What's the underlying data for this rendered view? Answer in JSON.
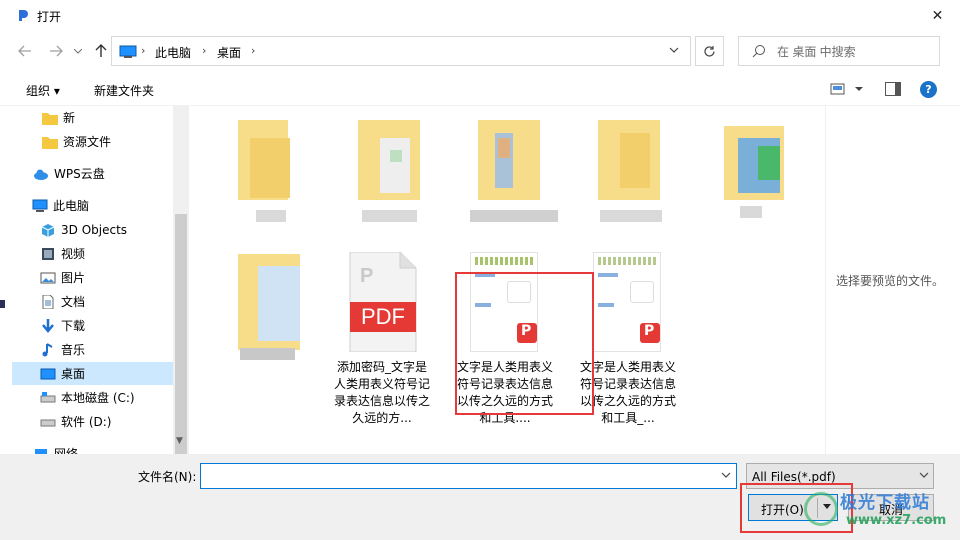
{
  "window": {
    "title": "打开",
    "close_label": "✕"
  },
  "address": {
    "crumbs": [
      "此电脑",
      "桌面"
    ],
    "search_placeholder": "在 桌面 中搜索"
  },
  "toolbar": {
    "organize": "组织 ▾",
    "new_folder": "新建文件夹",
    "help": "?"
  },
  "nav": {
    "items": [
      {
        "label": "新",
        "icon": "folder-icon"
      },
      {
        "label": "资源文件",
        "icon": "folder-icon"
      },
      {
        "label": "WPS云盘",
        "icon": "cloud-icon"
      },
      {
        "label": "此电脑",
        "icon": "computer-icon"
      },
      {
        "label": "3D Objects",
        "icon": "3d-objects-icon"
      },
      {
        "label": "视频",
        "icon": "video-icon"
      },
      {
        "label": "图片",
        "icon": "picture-icon"
      },
      {
        "label": "文档",
        "icon": "document-icon"
      },
      {
        "label": "下载",
        "icon": "download-icon"
      },
      {
        "label": "音乐",
        "icon": "music-icon"
      },
      {
        "label": "桌面",
        "icon": "desktop-icon",
        "selected": true
      },
      {
        "label": "本地磁盘 (C:)",
        "icon": "drive-icon"
      },
      {
        "label": "软件 (D:)",
        "icon": "drive-icon"
      },
      {
        "label": "网络",
        "icon": "network-icon"
      }
    ]
  },
  "files": [
    {
      "name": "",
      "kind": "folder-blurred"
    },
    {
      "name": "",
      "kind": "folder-blurred"
    },
    {
      "name": "",
      "kind": "folder-blurred"
    },
    {
      "name": "",
      "kind": "folder-blurred"
    },
    {
      "name": "",
      "kind": "folder-blurred"
    },
    {
      "name": "",
      "kind": "folder-blurred"
    },
    {
      "name": "添加密码_文字是人类用表义符号记录表达信息以传之久远的方...",
      "kind": "pdf-generic"
    },
    {
      "name": "文字是人类用表义符号记录表达信息以传之久远的方式和工具....",
      "kind": "pdf-preview",
      "highlighted": true
    },
    {
      "name": "文字是人类用表义符号记录表达信息以传之久远的方式和工具_...",
      "kind": "pdf-preview"
    }
  ],
  "pdf_badge": "PDF",
  "preview": {
    "message": "选择要预览的文件。"
  },
  "bottom": {
    "filename_label": "文件名(N):",
    "filename_value": "",
    "filetype": "All Files(*.pdf)",
    "open_label": "打开(O)",
    "cancel_label": "取消"
  },
  "watermark": {
    "line1": "极光下载站",
    "line2": "www.xz7.com"
  },
  "colors": {
    "accent": "#0078d7",
    "selection": "#cce8ff",
    "highlight_box": "#e63a3a",
    "pdf_red": "#e53935"
  }
}
